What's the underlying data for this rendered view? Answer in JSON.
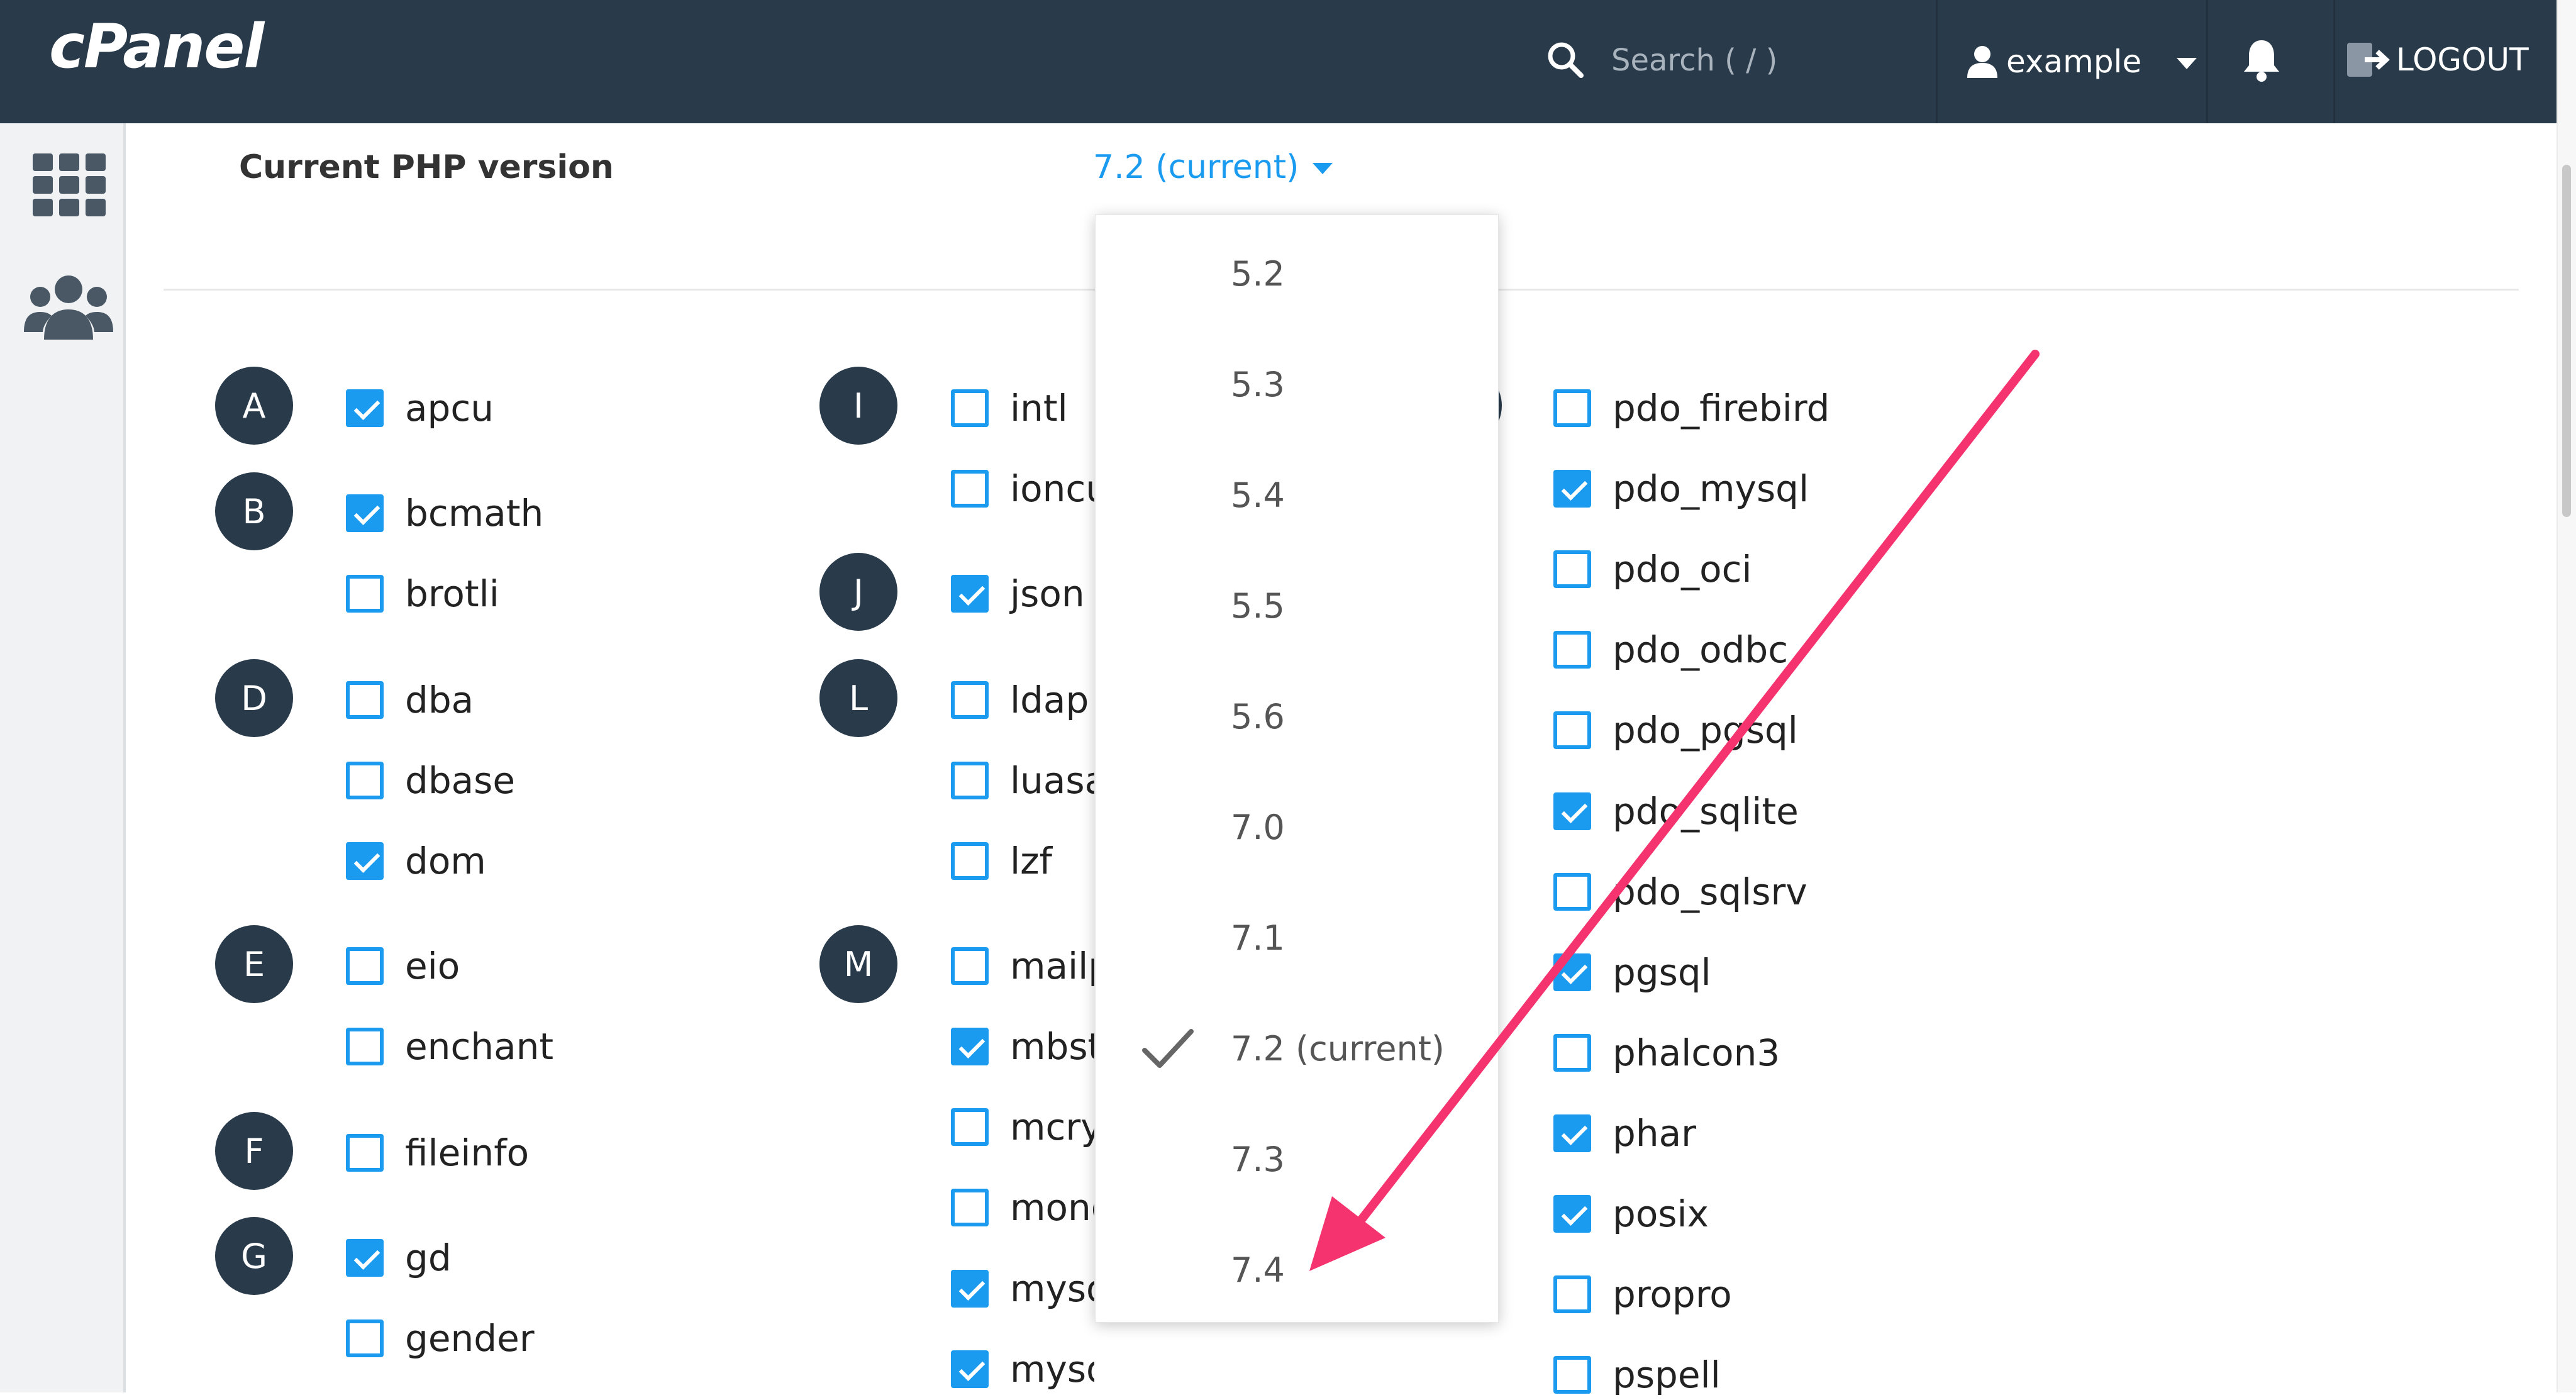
{
  "header": {
    "logo": "cPanel",
    "search_placeholder": "Search ( / )",
    "user": "example",
    "logout": "LOGOUT"
  },
  "php": {
    "label": "Current PHP version",
    "selected": "7.2 (current)",
    "options": [
      "5.2",
      "5.3",
      "5.4",
      "5.5",
      "5.6",
      "7.0",
      "7.1",
      "7.2 (current)",
      "7.3",
      "7.4"
    ],
    "selected_index": 7
  },
  "letters": [
    "A",
    "B",
    "D",
    "E",
    "F",
    "G",
    "I",
    "J",
    "L",
    "M"
  ],
  "col1": [
    {
      "name": "apcu",
      "checked": true
    },
    {
      "name": "bcmath",
      "checked": true
    },
    {
      "name": "brotli",
      "checked": false
    },
    {
      "name": "dba",
      "checked": false
    },
    {
      "name": "dbase",
      "checked": false
    },
    {
      "name": "dom",
      "checked": true
    },
    {
      "name": "eio",
      "checked": false
    },
    {
      "name": "enchant",
      "checked": false
    },
    {
      "name": "fileinfo",
      "checked": false
    },
    {
      "name": "gd",
      "checked": true
    },
    {
      "name": "gender",
      "checked": false
    }
  ],
  "col2": [
    {
      "name": "intl",
      "checked": false
    },
    {
      "name": "ioncu",
      "checked": false
    },
    {
      "name": "json",
      "checked": true
    },
    {
      "name": "ldap",
      "checked": false
    },
    {
      "name": "luasa",
      "checked": false
    },
    {
      "name": "lzf",
      "checked": false
    },
    {
      "name": "mailp",
      "checked": false
    },
    {
      "name": "mbst",
      "checked": true
    },
    {
      "name": "mcryp",
      "checked": false
    },
    {
      "name": "mong",
      "checked": false
    },
    {
      "name": "mysq",
      "checked": true
    },
    {
      "name": "mysqlnd",
      "checked": true
    }
  ],
  "col3": [
    {
      "name": "pdo_firebird",
      "checked": false
    },
    {
      "name": "pdo_mysql",
      "checked": true
    },
    {
      "name": "pdo_oci",
      "checked": false
    },
    {
      "name": "pdo_odbc",
      "checked": false
    },
    {
      "name": "pdo_pgsql",
      "checked": false
    },
    {
      "name": "pdo_sqlite",
      "checked": true
    },
    {
      "name": "pdo_sqlsrv",
      "checked": false
    },
    {
      "name": "pgsql",
      "checked": true
    },
    {
      "name": "phalcon3",
      "checked": false
    },
    {
      "name": "phar",
      "checked": true
    },
    {
      "name": "posix",
      "checked": true
    },
    {
      "name": "propro",
      "checked": false
    },
    {
      "name": "pspell",
      "checked": false
    }
  ],
  "colors": {
    "topbar": "#293a4a",
    "accent": "#1a9bf0",
    "annotation_arrow": "#f5336f"
  },
  "icons": [
    "search-icon",
    "user-icon",
    "bell-icon",
    "logout-icon",
    "apps-grid-icon",
    "users-icon",
    "checkmark-icon"
  ]
}
